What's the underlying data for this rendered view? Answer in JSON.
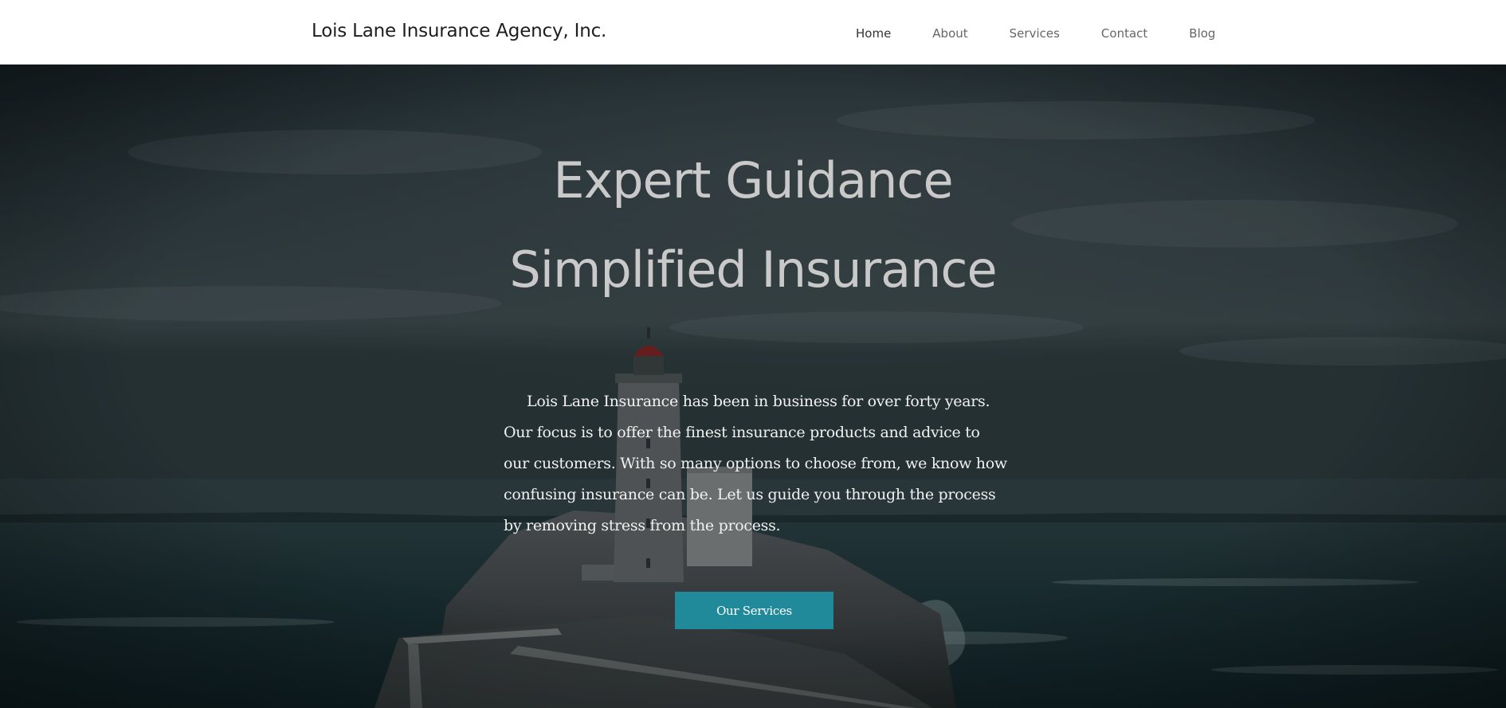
{
  "header": {
    "brand": "Lois Lane Insurance Agency, Inc.",
    "nav": [
      {
        "label": "Home",
        "active": true
      },
      {
        "label": "About",
        "active": false
      },
      {
        "label": "Services",
        "active": false
      },
      {
        "label": "Contact",
        "active": false
      },
      {
        "label": "Blog",
        "active": false
      }
    ]
  },
  "hero": {
    "headline_line1": "Expert Guidance",
    "headline_line2": "Simplified Insurance",
    "body": "Lois Lane Insurance has been in business for over forty years.  Our focus is to offer the finest insurance products and advice to our customers.  With so many options to choose from, we know how confusing insurance can be.  Let us guide you through the process by removing stress from the process.",
    "cta_label": "Our Services",
    "background_image": "lighthouse-on-rocky-coast-stormy-sea"
  },
  "colors": {
    "header_bg": "#ffffff",
    "brand_text": "#1e1e1e",
    "nav_text": "#666666",
    "headline": "#c9c9c9",
    "body_text": "#f1f1f1",
    "cta_bg": "#218a9a"
  }
}
